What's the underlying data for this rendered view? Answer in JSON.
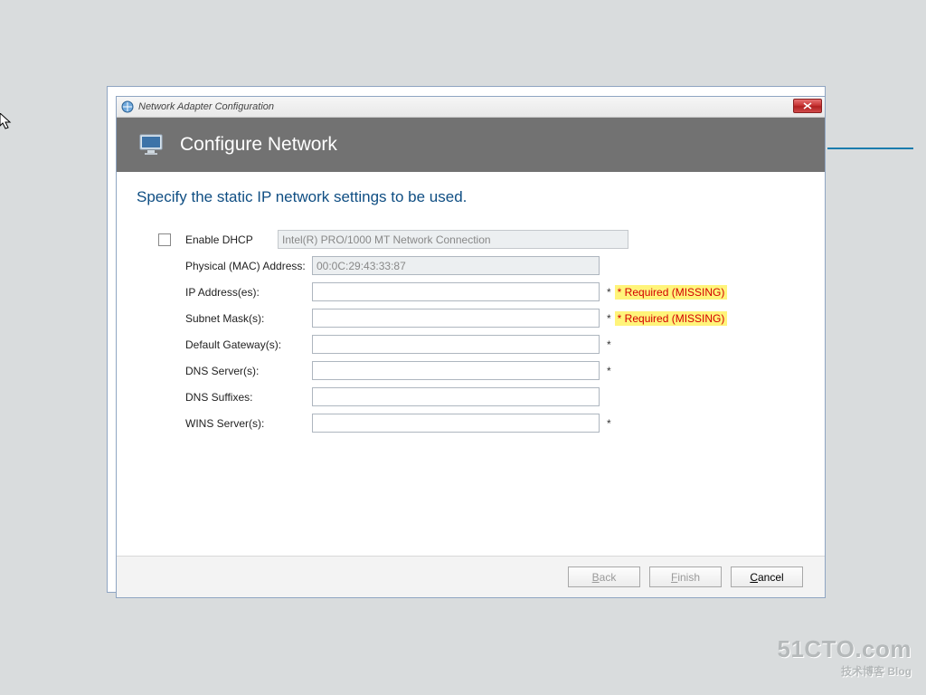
{
  "titlebar": {
    "title": "Network Adapter Configuration"
  },
  "header": {
    "title": "Configure Network"
  },
  "instruction": "Specify the static IP network settings to be used.",
  "form": {
    "enable_dhcp_label": "Enable DHCP",
    "adapter_name": "Intel(R) PRO/1000 MT Network Connection",
    "fields": {
      "mac": {
        "label": "Physical (MAC) Address:",
        "value": "00:0C:29:43:33:87",
        "required": false,
        "missing": false
      },
      "ip": {
        "label": "IP Address(es):",
        "value": "",
        "required": true,
        "missing": true
      },
      "subnet": {
        "label": "Subnet Mask(s):",
        "value": "",
        "required": true,
        "missing": true
      },
      "gateway": {
        "label": "Default Gateway(s):",
        "value": "",
        "required": true,
        "missing": false
      },
      "dns": {
        "label": "DNS Server(s):",
        "value": "",
        "required": true,
        "missing": false
      },
      "suffix": {
        "label": "DNS Suffixes:",
        "value": "",
        "required": false,
        "missing": false
      },
      "wins": {
        "label": "WINS Server(s):",
        "value": "",
        "required": true,
        "missing": false
      }
    },
    "asterisk": "*",
    "required_missing_text": "* Required (MISSING)"
  },
  "footer": {
    "back": "Back",
    "finish": "Finish",
    "cancel": "Cancel"
  },
  "watermark": {
    "line1": "51CTO.com",
    "line2": "技术博客  Blog"
  }
}
